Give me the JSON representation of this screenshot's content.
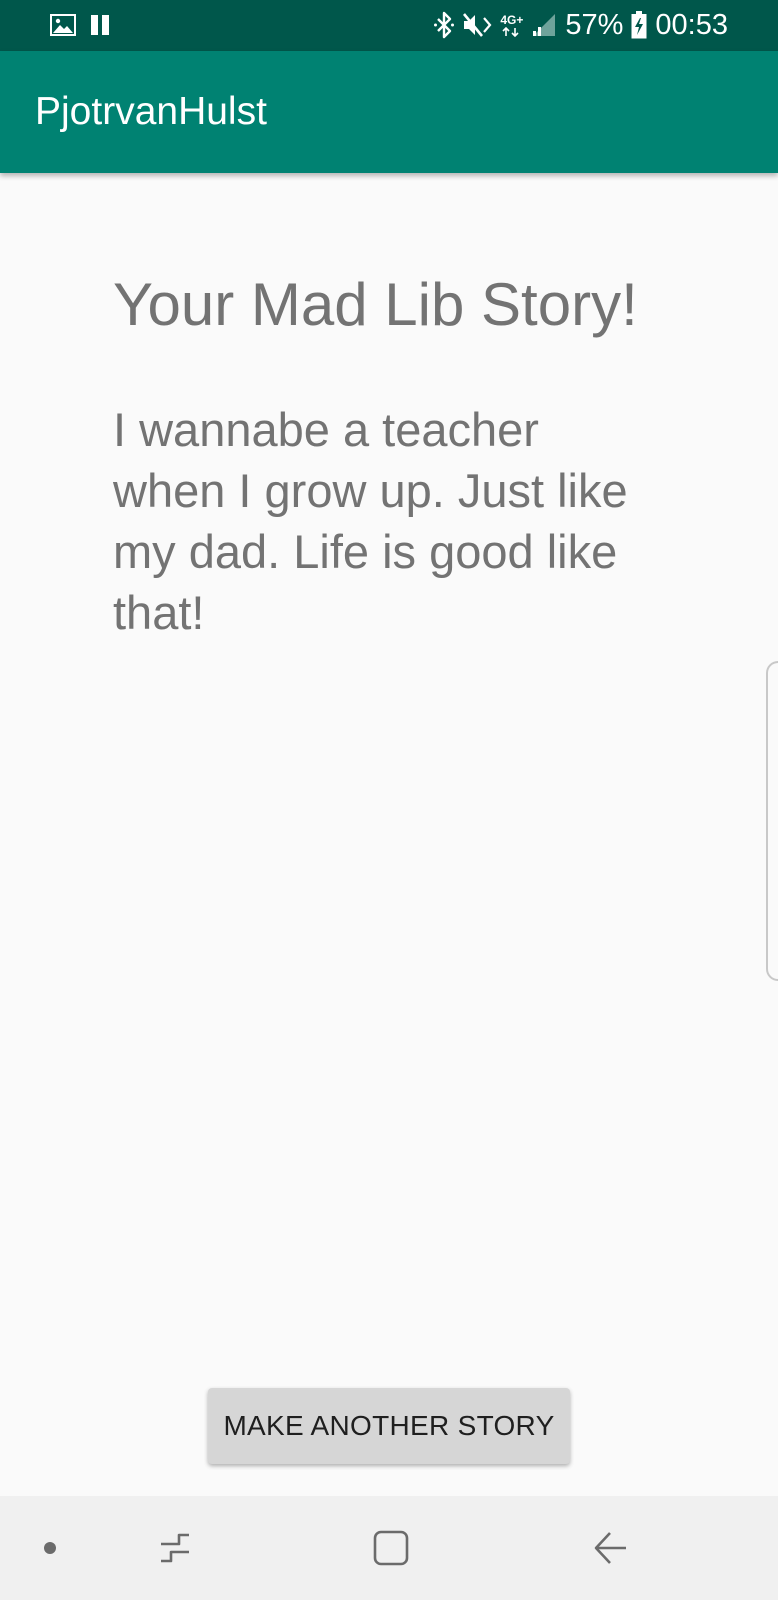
{
  "status_bar": {
    "left_icons": [
      "image-icon",
      "pause-icon"
    ],
    "right_icons": [
      "bluetooth-icon",
      "mute-icon",
      "network-4g-icon",
      "signal-icon",
      "battery-charging-icon"
    ],
    "network_label": "4G+",
    "battery_percent": "57%",
    "time": "00:53"
  },
  "app_bar": {
    "title": "PjotrvanHulst"
  },
  "story": {
    "heading": "Your Mad Lib Story!",
    "text": "I wannabe a teacher when I grow up. Just like my dad. Life is good like that!"
  },
  "actions": {
    "make_another_label": "MAKE ANOTHER STORY"
  },
  "nav_bar": {
    "items": [
      "dot-icon",
      "recents-icon",
      "home-icon",
      "back-icon"
    ]
  },
  "colors": {
    "status_bar": "#00574b",
    "app_bar": "#008272",
    "background": "#fafafa",
    "text_gray": "#737373",
    "button": "#d6d6d6",
    "nav_bar": "#f0f0f0"
  }
}
